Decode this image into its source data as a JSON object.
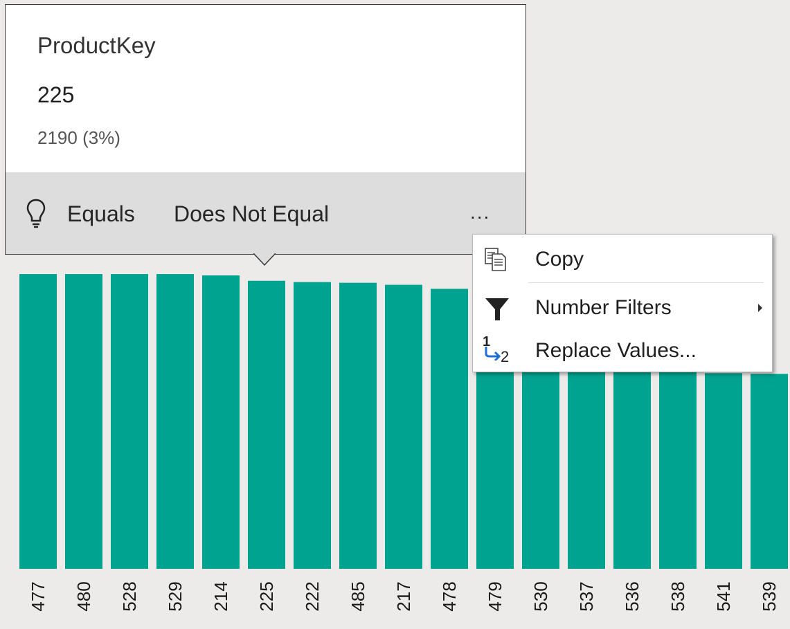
{
  "tooltip": {
    "field_name": "ProductKey",
    "value": "225",
    "count_text": "2190 (3%)",
    "actions": {
      "equals_label": "Equals",
      "not_equal_label": "Does Not Equal",
      "more_label": "..."
    }
  },
  "context_menu": {
    "items": [
      {
        "label": "Copy",
        "icon": "copy-icon"
      },
      {
        "label": "Number Filters",
        "icon": "filter-icon",
        "has_submenu": true
      },
      {
        "label": "Replace Values...",
        "icon": "replace-values-icon",
        "icon_text_1": "1",
        "icon_text_2": "2"
      }
    ]
  },
  "colors": {
    "bar": "#00a38f",
    "background": "#edebe9",
    "replace_arrow": "#1e6ed8"
  },
  "chart_data": {
    "type": "bar",
    "categories": [
      "477",
      "480",
      "528",
      "529",
      "214",
      "225",
      "222",
      "485",
      "217",
      "478",
      "479",
      "530",
      "537",
      "536",
      "538",
      "541",
      "539"
    ],
    "values": [
      2200,
      2200,
      2200,
      2200,
      2190,
      2150,
      2140,
      2135,
      2120,
      2090,
      1800,
      1640,
      1680,
      1570,
      1510,
      1460,
      1455
    ],
    "xlabel": "",
    "ylabel": "",
    "ylim": [
      0,
      2500
    ],
    "x_tick_rotation": "vertical"
  }
}
